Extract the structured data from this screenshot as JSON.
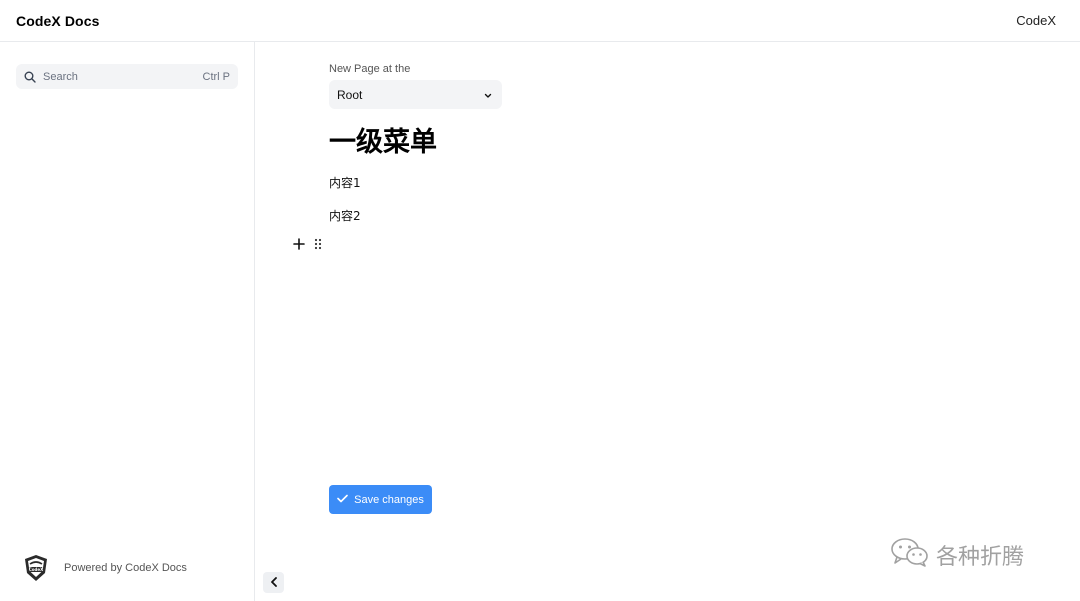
{
  "header": {
    "brand": "CodeX Docs",
    "link": "CodeX"
  },
  "sidebar": {
    "search": {
      "placeholder": "Search",
      "shortcut": "Ctrl P",
      "icon": "search-icon"
    },
    "footer": {
      "text": "Powered by CodeX Docs",
      "logo": "codex-logo"
    },
    "collapse_icon": "chevron-left-icon"
  },
  "editor": {
    "parent_label": "New Page at the",
    "parent_value": "Root",
    "heading": "一级菜单",
    "paragraphs": [
      "内容1",
      "内容2"
    ],
    "save_label": "Save changes"
  },
  "watermark": {
    "text": "各种折腾",
    "icon": "wechat-icon"
  },
  "colors": {
    "primary": "#3b8cf7",
    "input_bg": "#f3f4f6",
    "border": "#e8eaed"
  }
}
